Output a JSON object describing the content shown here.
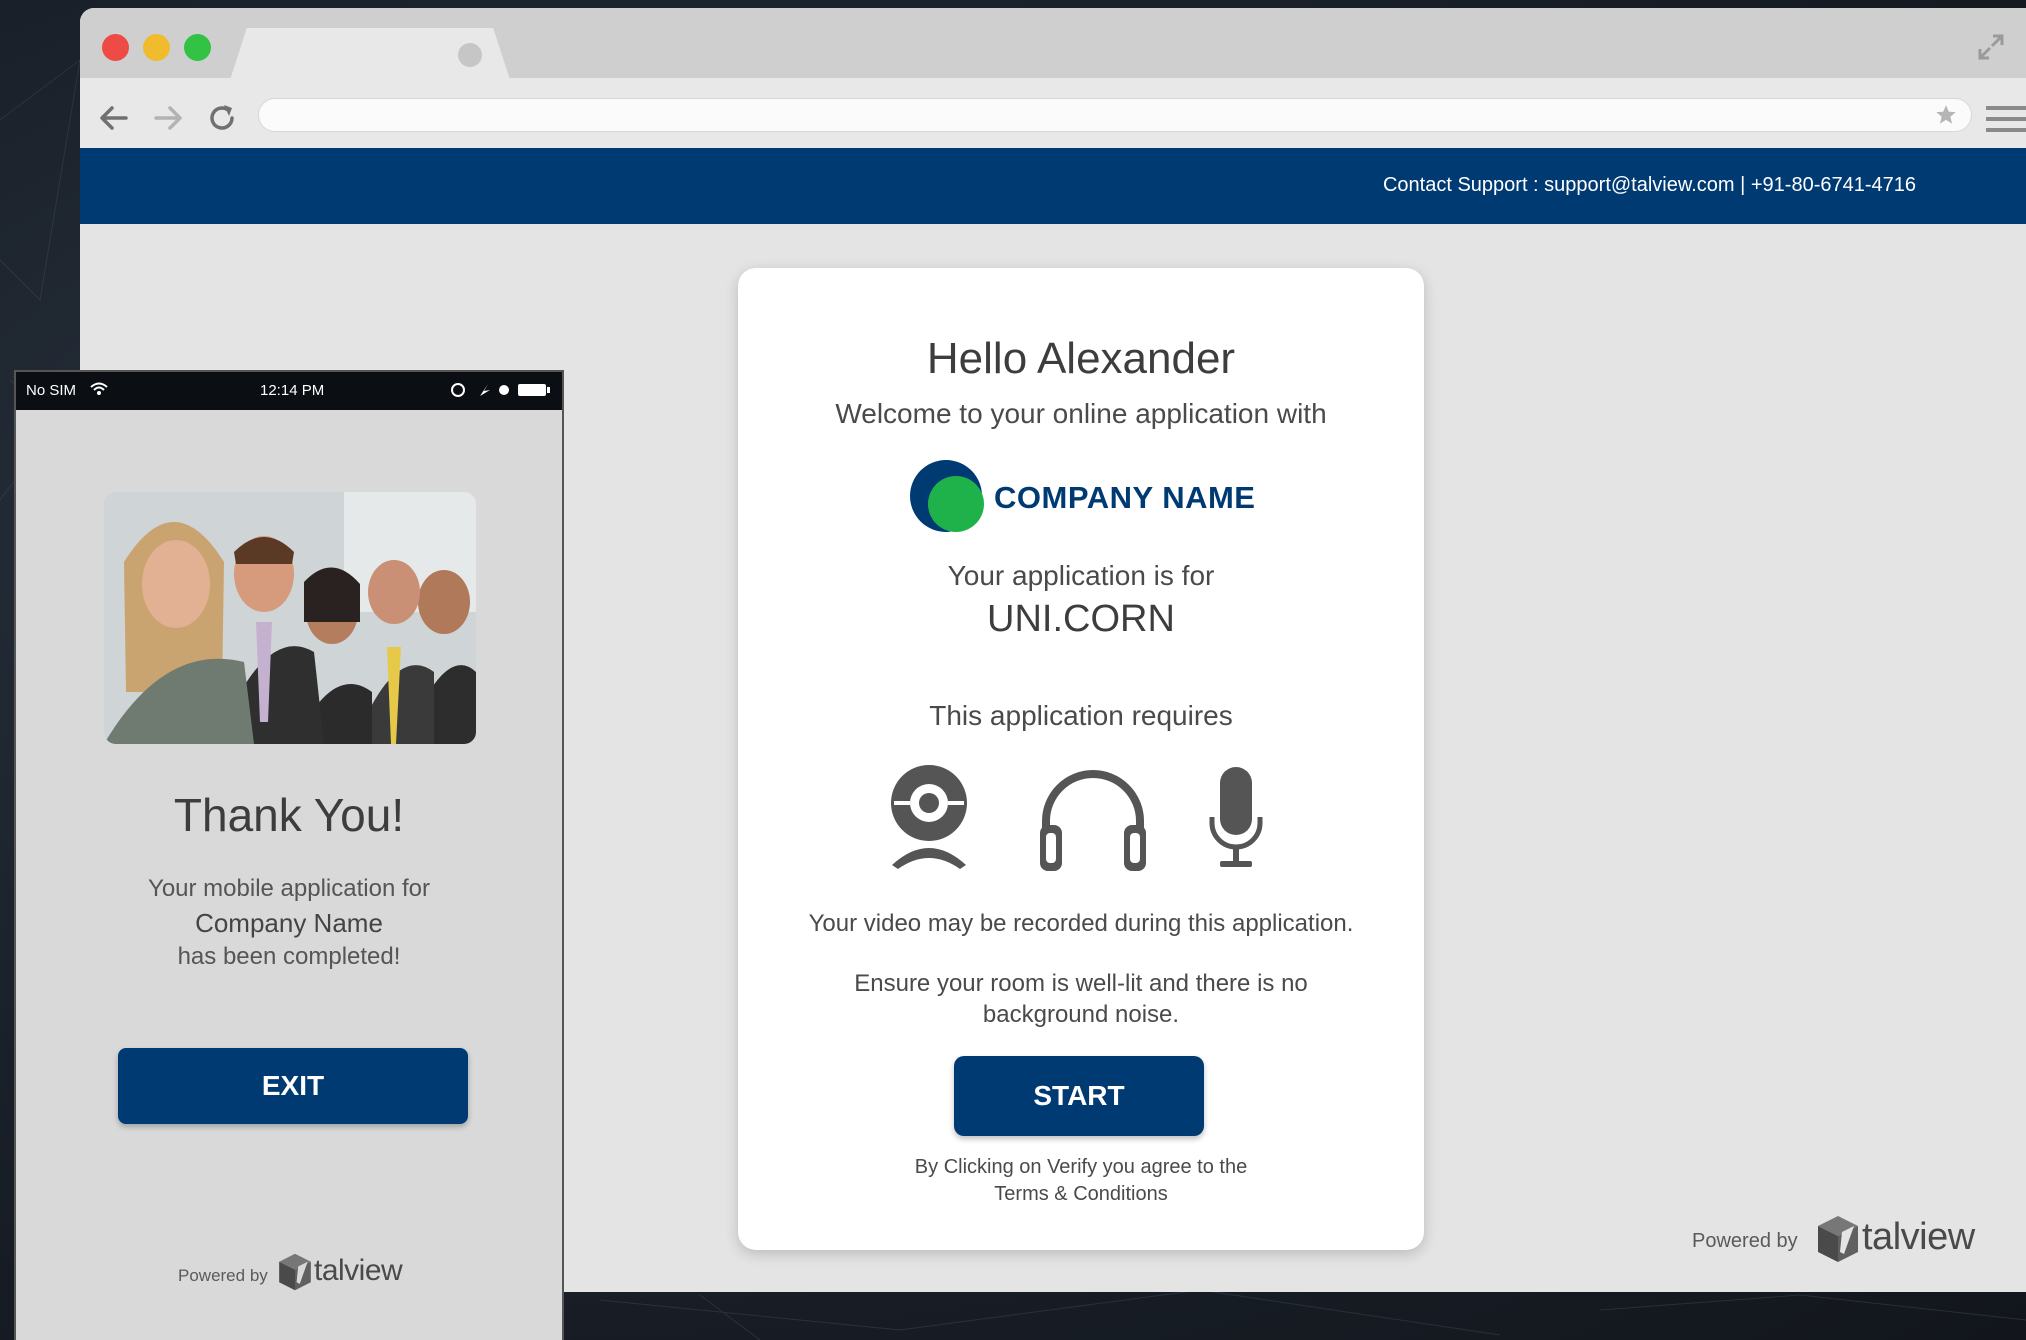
{
  "browser": {
    "address": ""
  },
  "header": {
    "contact_support": "Contact Support : support@talview.com | +91-80-6741-4716"
  },
  "card": {
    "greeting": "Hello Alexander",
    "welcome": "Welcome to your online application with",
    "company_name": "COMPANY NAME",
    "application_for_label": "Your application is for",
    "position": "UNI.CORN",
    "requires_label": "This application requires",
    "requirements": [
      "webcam-icon",
      "headphones-icon",
      "microphone-icon"
    ],
    "video_note": "Your video may be recorded during this application.",
    "room_note": "Ensure your room is well-lit and there is no background noise.",
    "start_label": "START",
    "agree_line1": "By Clicking on Verify you agree to the",
    "agree_line2": "Terms & Conditions"
  },
  "powered": {
    "label": "Powered by",
    "brand": "talview"
  },
  "phone": {
    "carrier": "No SIM",
    "time": "12:14 PM",
    "thanks": "Thank You!",
    "msg_line1": "Your mobile application for",
    "msg_company": "Company Name",
    "msg_line3": "has been completed!",
    "exit_label": "EXIT"
  },
  "colors": {
    "brand_navy": "#003a73",
    "logo_green": "#1fb24a",
    "traffic_red": "#ee4b47",
    "traffic_yellow": "#f0bb2c",
    "traffic_green": "#32c244"
  }
}
